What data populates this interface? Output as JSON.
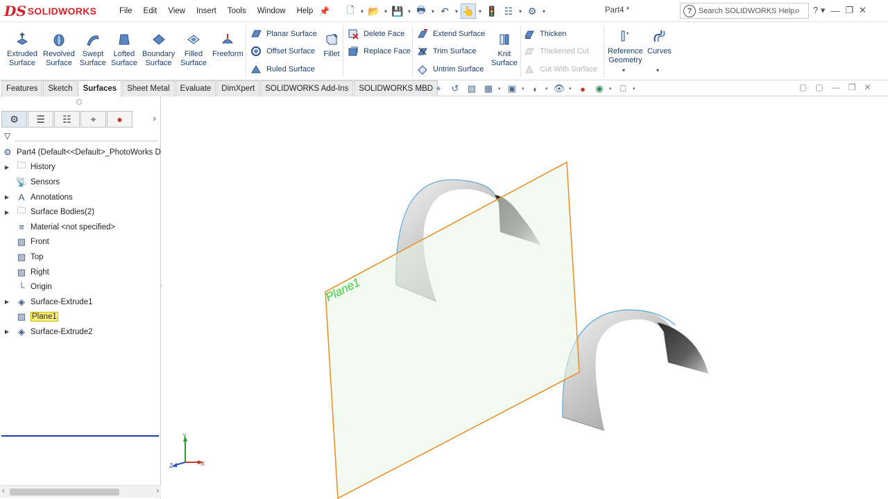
{
  "app": {
    "brand": "SOLIDWORKS",
    "document_title": "Part4 *",
    "menus": [
      "File",
      "Edit",
      "View",
      "Insert",
      "Tools",
      "Window",
      "Help"
    ],
    "help_search_placeholder": "Search SOLIDWORKS Help"
  },
  "ribbon": {
    "big_buttons": [
      {
        "label": "Extruded\nSurface",
        "icon": "extruded-surface-icon"
      },
      {
        "label": "Revolved\nSurface",
        "icon": "revolved-surface-icon"
      },
      {
        "label": "Swept\nSurface",
        "icon": "swept-surface-icon"
      },
      {
        "label": "Lofted\nSurface",
        "icon": "lofted-surface-icon"
      },
      {
        "label": "Boundary\nSurface",
        "icon": "boundary-surface-icon"
      },
      {
        "label": "Filled\nSurface",
        "icon": "filled-surface-icon"
      },
      {
        "label": "Freeform",
        "icon": "freeform-icon"
      }
    ],
    "surface_group": [
      "Planar Surface",
      "Offset Surface",
      "Ruled Surface"
    ],
    "fillet_label": "Fillet",
    "face_group": [
      "Delete Face",
      "Replace Face"
    ],
    "trim_group": [
      "Extend Surface",
      "Trim Surface",
      "Untrim Surface"
    ],
    "knit_label": "Knit\nSurface",
    "thicken_group": [
      {
        "label": "Thicken",
        "enabled": true
      },
      {
        "label": "Thickened Cut",
        "enabled": false
      },
      {
        "label": "Cut With Surface",
        "enabled": false
      }
    ],
    "reference_geometry_label": "Reference\nGeometry",
    "curves_label": "Curves"
  },
  "tabs": [
    {
      "label": "Features",
      "active": false
    },
    {
      "label": "Sketch",
      "active": false
    },
    {
      "label": "Surfaces",
      "active": true
    },
    {
      "label": "Sheet Metal",
      "active": false
    },
    {
      "label": "Evaluate",
      "active": false
    },
    {
      "label": "DimXpert",
      "active": false
    },
    {
      "label": "SOLIDWORKS Add-Ins",
      "active": false
    },
    {
      "label": "SOLIDWORKS MBD",
      "active": false
    }
  ],
  "tree": {
    "root_label": "Part4  (Default<<Default>_PhotoWorks D",
    "items": [
      {
        "label": "History",
        "icon": "history-folder-icon",
        "expandable": true,
        "highlighted": false
      },
      {
        "label": "Sensors",
        "icon": "sensors-icon",
        "expandable": false,
        "highlighted": false
      },
      {
        "label": "Annotations",
        "icon": "annotations-icon",
        "expandable": true,
        "highlighted": false
      },
      {
        "label": "Surface Bodies(2)",
        "icon": "surface-bodies-icon",
        "expandable": true,
        "highlighted": false
      },
      {
        "label": "Material <not specified>",
        "icon": "material-icon",
        "expandable": false,
        "highlighted": false
      },
      {
        "label": "Front",
        "icon": "plane-icon",
        "expandable": false,
        "highlighted": false
      },
      {
        "label": "Top",
        "icon": "plane-icon",
        "expandable": false,
        "highlighted": false
      },
      {
        "label": "Right",
        "icon": "plane-icon",
        "expandable": false,
        "highlighted": false
      },
      {
        "label": "Origin",
        "icon": "origin-icon",
        "expandable": false,
        "highlighted": false
      },
      {
        "label": "Surface-Extrude1",
        "icon": "surface-extrude-icon",
        "expandable": true,
        "highlighted": false
      },
      {
        "label": "Plane1",
        "icon": "plane-icon",
        "expandable": false,
        "highlighted": true
      },
      {
        "label": "Surface-Extrude2",
        "icon": "surface-extrude-icon",
        "expandable": true,
        "highlighted": false
      }
    ]
  },
  "viewport": {
    "plane_label": "Plane1",
    "plane_edge_color": "#e8912b",
    "plane_label_color": "#3bd13b",
    "surface_edge_color": "#5aa9d6",
    "triad": {
      "x": "X",
      "y": "Y",
      "z": "Z"
    }
  }
}
